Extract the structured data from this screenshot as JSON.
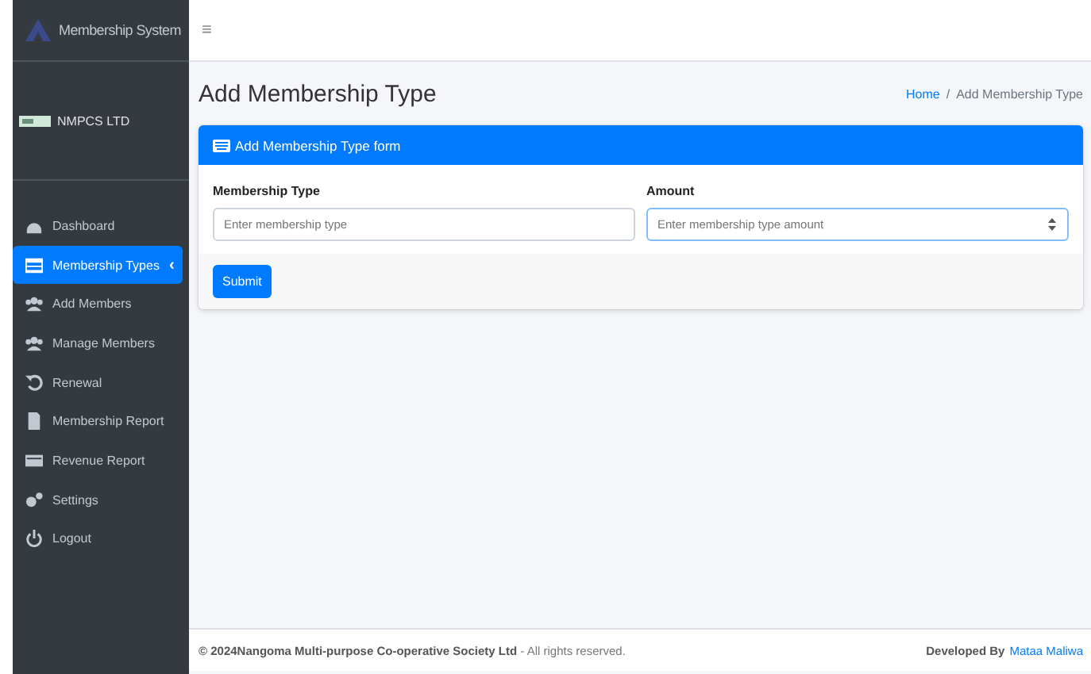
{
  "brand": {
    "title": "Membership System"
  },
  "user": {
    "name": "NMPCS LTD"
  },
  "nav": [
    {
      "label": "Dashboard",
      "selected": false
    },
    {
      "label": "Membership Types",
      "selected": true,
      "caret": "‹"
    },
    {
      "label": "Add Members",
      "selected": false
    },
    {
      "label": "Manage Members",
      "selected": false
    },
    {
      "label": "Renewal",
      "selected": false
    },
    {
      "label": "Membership Report",
      "selected": false
    },
    {
      "label": "Revenue Report",
      "selected": false
    },
    {
      "label": "Settings",
      "selected": false
    },
    {
      "label": "Logout",
      "selected": false
    }
  ],
  "topbar": {
    "menu": "≡"
  },
  "page": {
    "title": "Add Membership Type",
    "breadcrumb": [
      "Home",
      "Add Membership Type"
    ],
    "separator": "/"
  },
  "card": {
    "title": "Add Membership Type form",
    "fields": [
      {
        "label": "Membership Type",
        "placeholder": "Enter membership type",
        "kind": "text"
      },
      {
        "label": "Amount",
        "placeholder": "Enter membership type amount",
        "kind": "number"
      }
    ],
    "submit": "Submit"
  },
  "footer": {
    "copyright": "© 2024Nangoma Multi-purpose Co-operative Society Ltd",
    "rights": " - All rights reserved.",
    "developed": "Developed By",
    "author": "Mataa Maliwa"
  }
}
